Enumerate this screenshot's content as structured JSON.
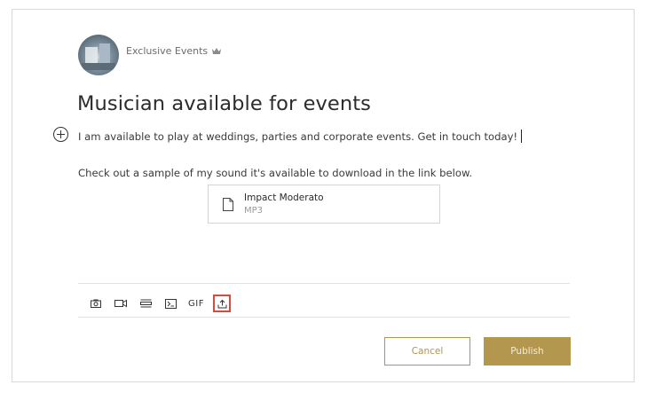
{
  "post": {
    "author": "Exclusive Events",
    "title": "Musician available for events",
    "paragraph1": "I am available to play at weddings, parties and corporate events. Get in touch today!",
    "paragraph2": "Check out a sample of my sound  it's available to download in the link below."
  },
  "attachment": {
    "name": "Impact Moderato",
    "type": "MP3"
  },
  "toolbar": {
    "gif_label": "GIF",
    "items": [
      "camera-icon",
      "video-icon",
      "divider-icon",
      "code-icon",
      "gif",
      "upload-icon"
    ],
    "active_item": "upload-icon"
  },
  "actions": {
    "cancel_label": "Cancel",
    "publish_label": "Publish"
  },
  "colors": {
    "accent": "#b3974f",
    "active_outline": "#e0473b"
  }
}
